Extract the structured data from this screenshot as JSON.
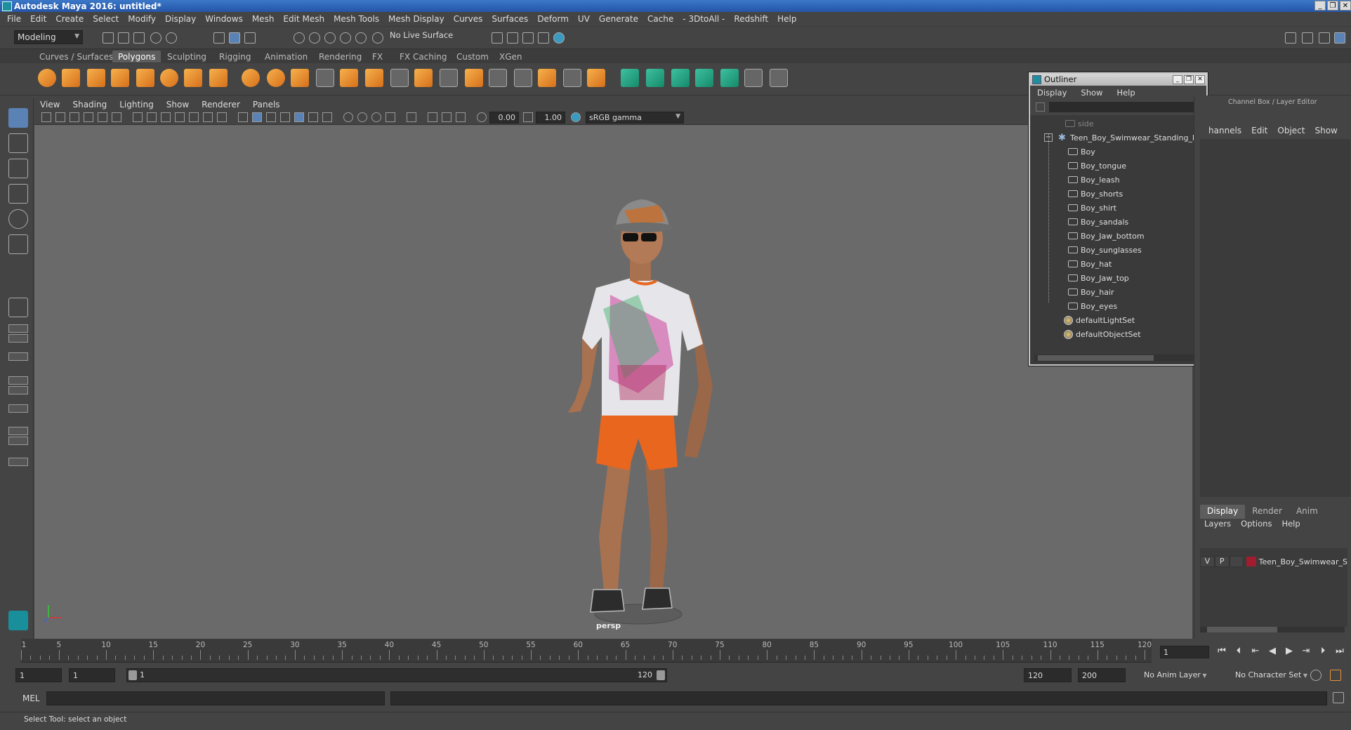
{
  "window": {
    "title": "Autodesk Maya 2016: untitled*",
    "controls": [
      "_",
      "❐",
      "✕"
    ]
  },
  "menubar": [
    "File",
    "Edit",
    "Create",
    "Select",
    "Modify",
    "Display",
    "Windows",
    "Mesh",
    "Edit Mesh",
    "Mesh Tools",
    "Mesh Display",
    "Curves",
    "Surfaces",
    "Deform",
    "UV",
    "Generate",
    "Cache",
    "- 3DtoAll -",
    "Redshift",
    "Help"
  ],
  "statusline": {
    "mode": "Modeling",
    "live_surface": "No Live Surface"
  },
  "shelf": {
    "tabs": [
      "Curves / Surfaces",
      "Polygons",
      "Sculpting",
      "Rigging",
      "Animation",
      "Rendering",
      "FX",
      "FX Caching",
      "Custom",
      "XGen"
    ],
    "active_tab": "Polygons"
  },
  "viewport": {
    "menus": [
      "View",
      "Shading",
      "Lighting",
      "Show",
      "Renderer",
      "Panels"
    ],
    "exposure": "0.00",
    "gamma_value": "1.00",
    "color_space": "sRGB gamma",
    "camera": "persp"
  },
  "outliner": {
    "title": "Outliner",
    "menus": [
      "Display",
      "Show",
      "Help"
    ],
    "items": [
      {
        "label": "side",
        "type": "camera",
        "indent": 0
      },
      {
        "label": "Teen_Boy_Swimwear_Standing_Po",
        "type": "group",
        "indent": 0
      },
      {
        "label": "Boy",
        "type": "mesh",
        "indent": 1
      },
      {
        "label": "Boy_tongue",
        "type": "mesh",
        "indent": 1
      },
      {
        "label": "Boy_leash",
        "type": "mesh",
        "indent": 1
      },
      {
        "label": "Boy_shorts",
        "type": "mesh",
        "indent": 1
      },
      {
        "label": "Boy_shirt",
        "type": "mesh",
        "indent": 1
      },
      {
        "label": "Boy_sandals",
        "type": "mesh",
        "indent": 1
      },
      {
        "label": "Boy_Jaw_bottom",
        "type": "mesh",
        "indent": 1
      },
      {
        "label": "Boy_sunglasses",
        "type": "mesh",
        "indent": 1
      },
      {
        "label": "Boy_hat",
        "type": "mesh",
        "indent": 1
      },
      {
        "label": "Boy_Jaw_top",
        "type": "mesh",
        "indent": 1
      },
      {
        "label": "Boy_hair",
        "type": "mesh",
        "indent": 1
      },
      {
        "label": "Boy_eyes",
        "type": "mesh",
        "indent": 1
      },
      {
        "label": "defaultLightSet",
        "type": "set",
        "indent": 0
      },
      {
        "label": "defaultObjectSet",
        "type": "set",
        "indent": 0
      }
    ]
  },
  "channelbox": {
    "title": "Channel Box / Layer Editor",
    "menus": [
      "hannels",
      "Edit",
      "Object",
      "Show"
    ]
  },
  "layers": {
    "tabs": [
      "Display",
      "Render",
      "Anim"
    ],
    "active_tab": "Display",
    "menus": [
      "Layers",
      "Options",
      "Help"
    ],
    "layer": {
      "v": "V",
      "p": "P",
      "name": "Teen_Boy_Swimwear_S",
      "color": "#a01c2e"
    }
  },
  "timeline": {
    "ticks": [
      1,
      5,
      10,
      15,
      20,
      25,
      30,
      35,
      40,
      45,
      50,
      55,
      60,
      65,
      70,
      75,
      80,
      85,
      90,
      95,
      100,
      105,
      110,
      115,
      120
    ],
    "current_frame": "1",
    "start": 1,
    "end": 120
  },
  "range": {
    "start_a": "1",
    "start_b": "1",
    "slider_start": "1",
    "slider_end": "120",
    "end_a": "120",
    "end_b": "200",
    "anim_layer": "No Anim Layer",
    "character_set": "No Character Set"
  },
  "commandline": {
    "lang": "MEL"
  },
  "helpline": "Select Tool: select an object",
  "colors": {
    "accent": "#5b82b4",
    "shelf_orange": "#e8913a",
    "layer_red": "#a01c2e"
  }
}
